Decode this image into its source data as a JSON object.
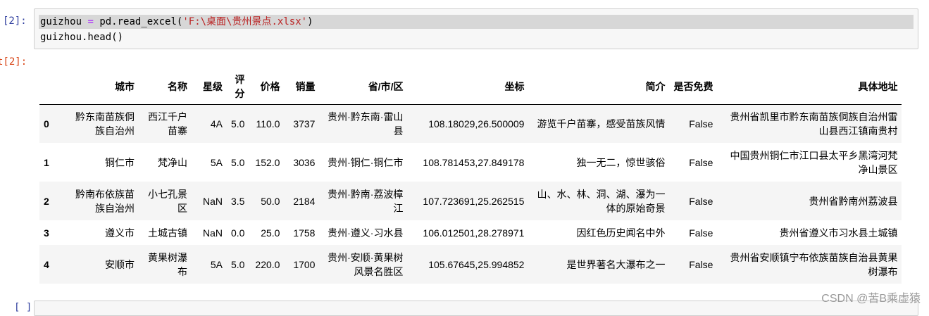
{
  "cell1": {
    "in_prompt": "[2]:",
    "code_var": "guizhou",
    "code_op": "=",
    "code_call": "pd.read_excel(",
    "code_str": "'F:\\桌面\\贵州景点.xlsx'",
    "code_close": ")",
    "code_line2": "guizhou.head()",
    "out_prompt": "t[2]:"
  },
  "cell2": {
    "in_prompt": "[ ]:"
  },
  "dataframe": {
    "columns": [
      "",
      "城市",
      "名称",
      "星级",
      "评分",
      "价格",
      "销量",
      "省/市/区",
      "坐标",
      "简介",
      "是否免费",
      "具体地址"
    ],
    "rows": [
      [
        "0",
        "黔东南苗族侗族自治州",
        "西江千户苗寨",
        "4A",
        "5.0",
        "110.0",
        "3737",
        "贵州·黔东南·雷山县",
        "108.18029,26.500009",
        "游览千户苗寨，感受苗族风情",
        "False",
        "贵州省凯里市黔东南苗族侗族自治州雷山县西江镇南贵村"
      ],
      [
        "1",
        "铜仁市",
        "梵净山",
        "5A",
        "5.0",
        "152.0",
        "3036",
        "贵州·铜仁·铜仁市",
        "108.781453,27.849178",
        "独一无二，惊世骇俗",
        "False",
        "中国贵州铜仁市江口县太平乡黑湾河梵净山景区"
      ],
      [
        "2",
        "黔南布依族苗族自治州",
        "小七孔景区",
        "NaN",
        "3.5",
        "50.0",
        "2184",
        "贵州·黔南·荔波樟江",
        "107.723691,25.262515",
        "山、水、林、洞、湖、瀑为一体的原始奇景",
        "False",
        "贵州省黔南州荔波县"
      ],
      [
        "3",
        "遵义市",
        "土城古镇",
        "NaN",
        "0.0",
        "25.0",
        "1758",
        "贵州·遵义·习水县",
        "106.012501,28.278971",
        "因红色历史闻名中外",
        "False",
        "贵州省遵义市习水县土城镇"
      ],
      [
        "4",
        "安顺市",
        "黄果树瀑布",
        "5A",
        "5.0",
        "220.0",
        "1700",
        "贵州·安顺·黄果树风景名胜区",
        "105.67645,25.994852",
        "是世界著名大瀑布之一",
        "False",
        "贵州省安顺镇宁布依族苗族自治县黄果树瀑布"
      ]
    ]
  },
  "watermark": "CSDN @苦B乘虚猿"
}
